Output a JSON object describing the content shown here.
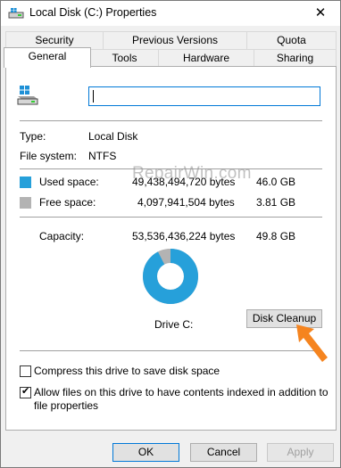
{
  "window": {
    "title": "Local Disk (C:) Properties",
    "close_glyph": "✕",
    "drive_icon_color": "#4a4a4a",
    "windows_logo_color": "#1e90d6"
  },
  "tabs": {
    "row1": [
      "Security",
      "Previous Versions",
      "Quota"
    ],
    "row2": [
      "General",
      "Tools",
      "Hardware",
      "Sharing"
    ],
    "active": "General"
  },
  "general": {
    "name_value": "",
    "type_label": "Type:",
    "type_value": "Local Disk",
    "fs_label": "File system:",
    "fs_value": "NTFS",
    "used": {
      "label": "Used space:",
      "bytes": "49,438,494,720 bytes",
      "size": "46.0 GB",
      "color": "#26a0da"
    },
    "free": {
      "label": "Free space:",
      "bytes": "4,097,941,504 bytes",
      "size": "3.81 GB",
      "color": "#b3b3b3"
    },
    "capacity": {
      "label": "Capacity:",
      "bytes": "53,536,436,224 bytes",
      "size": "49.8 GB"
    },
    "drive_label": "Drive C:",
    "cleanup_button": "Disk Cleanup",
    "used_fraction": 0.9234,
    "compress_label": "Compress this drive to save disk space",
    "compress_checked": false,
    "index_label_line1": "Allow files on this drive to have contents indexed in addition to",
    "index_label_line2": "file properties",
    "index_checked": true
  },
  "watermark": "RepairWin.com",
  "annotation_arrow_color": "#f5841f",
  "buttons": {
    "ok": "OK",
    "cancel": "Cancel",
    "apply": "Apply"
  }
}
